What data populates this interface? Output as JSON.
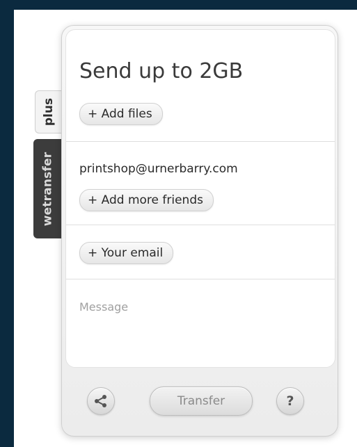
{
  "tabs": {
    "plus_label": "plus",
    "wetransfer_label": "wetransfer"
  },
  "form": {
    "title": "Send up to 2GB",
    "add_files_label": "+ Add files",
    "recipient_email": "printshop@urnerbarry.com",
    "add_friends_label": "+ Add more friends",
    "your_email_label": "+ Your email",
    "message_placeholder": "Message"
  },
  "footer": {
    "share_icon": "share-icon",
    "transfer_label": "Transfer",
    "help_label": "?"
  }
}
